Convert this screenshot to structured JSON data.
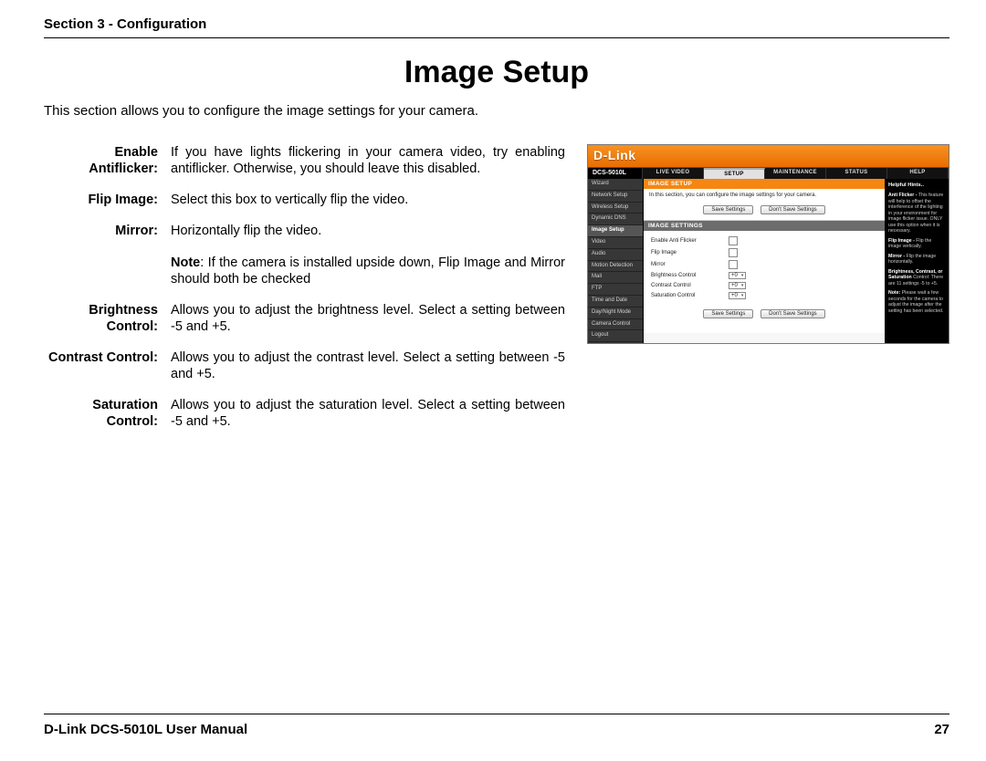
{
  "header": {
    "section_label": "Section 3 - Configuration"
  },
  "title": "Image Setup",
  "intro": "This section allows you to configure the image settings for your camera.",
  "definitions": [
    {
      "term": "Enable Antiflicker:",
      "desc": "If you have lights flickering in your camera video, try enabling antiflicker. Otherwise, you should leave this disabled."
    },
    {
      "term": "Flip Image:",
      "desc": "Select this box to vertically flip the video."
    },
    {
      "term": "Mirror:",
      "desc": "Horizontally flip the video."
    },
    {
      "term": "",
      "desc_pre": "Note",
      "desc": ": If the camera is installed upside down, Flip Image and Mirror should both be checked"
    },
    {
      "term": "Brightness Control:",
      "desc": "Allows you to adjust the brightness level. Select a setting between -5 and +5."
    },
    {
      "term": "Contrast Control:",
      "desc": "Allows you to adjust the contrast level. Select a setting between -5 and +5."
    },
    {
      "term": "Saturation Control:",
      "desc": "Allows you to adjust the saturation level. Select a setting between -5 and +5."
    }
  ],
  "shot": {
    "brand": "D-Link",
    "model": "DCS-5010L",
    "tabs": [
      "LIVE VIDEO",
      "SETUP",
      "MAINTENANCE",
      "STATUS",
      "HELP"
    ],
    "active_tab": "SETUP",
    "sidenav": [
      "Wizard",
      "Network Setup",
      "Wireless Setup",
      "Dynamic DNS",
      "Image Setup",
      "Video",
      "Audio",
      "Motion Detection",
      "Mail",
      "FTP",
      "Time and Date",
      "Day/Night Mode",
      "Camera Control",
      "Logout"
    ],
    "sidenav_active": "Image Setup",
    "banner": "IMAGE SETUP",
    "banner_sub": "In this section, you can configure the image settings for your camera.",
    "section_header": "IMAGE SETTINGS",
    "buttons": {
      "save": "Save Settings",
      "dont": "Don't Save Settings"
    },
    "settings": {
      "anti_flicker": "Enable Anti Flicker",
      "flip_image": "Flip Image",
      "mirror": "Mirror",
      "brightness": "Brightness Control",
      "contrast": "Contrast Control",
      "saturation": "Saturation Control",
      "sel_value": "+0"
    },
    "hints": {
      "title": "Helpful Hints..",
      "p1b": "Anti Flicker - ",
      "p1": "This feature will help to offset the interference of the lighting in your environment for image flicker issue. ONLY use this option when it is necessary.",
      "p2b": "Flip Image - ",
      "p2": "Flip the image vertically.",
      "p3b": "Mirror - ",
      "p3": "Flip the image horizontally.",
      "p4b": "Brightness, Contrast, or Saturation",
      "p4": " Control: There are 11 settings -5 to +5.",
      "p5b": "Note:",
      "p5": " Please wait a few seconds for the camera to adjust the image after the setting has been selected."
    }
  },
  "footer": {
    "left": "D-Link DCS-5010L User Manual",
    "right": "27"
  }
}
